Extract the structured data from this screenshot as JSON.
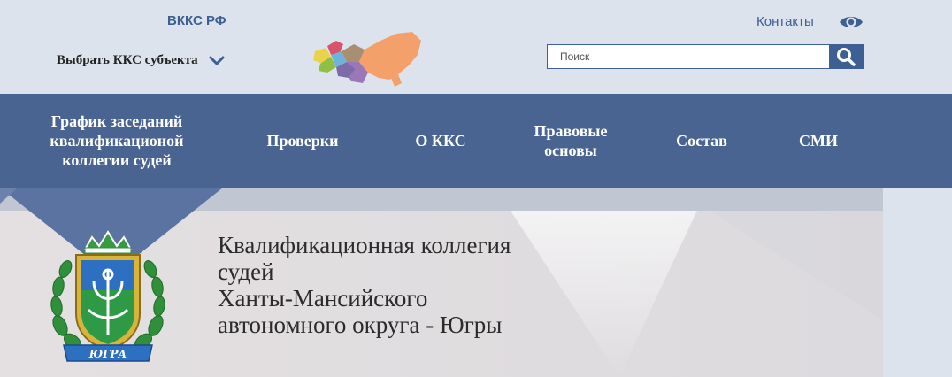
{
  "header": {
    "vkks_link": "ВККС РФ",
    "region_select_label": "Выбрать ККС субъекта",
    "contacts_link": "Контакты",
    "search_placeholder": "Поиск"
  },
  "nav": {
    "items": [
      {
        "label": "График заседаний квалификационой коллегии судей"
      },
      {
        "label": "Проверки"
      },
      {
        "label": "О ККС"
      },
      {
        "label": "Правовые основы"
      },
      {
        "label": "Состав"
      },
      {
        "label": "СМИ"
      }
    ]
  },
  "banner": {
    "title_lines": [
      "Квалификационная коллегия",
      "судей",
      "Ханты-Мансийского",
      "автономного округа - Югры"
    ],
    "emblem_text": "ЮГРА"
  },
  "colors": {
    "accent": "#3e5f93",
    "nav_bg": "#4a6491",
    "page_bg": "#dde3ec"
  },
  "icons": {
    "chevron": "chevron-down-icon",
    "eye": "eye-icon",
    "search": "search-icon",
    "map": "russia-map-icon",
    "emblem": "coat-of-arms-icon"
  }
}
